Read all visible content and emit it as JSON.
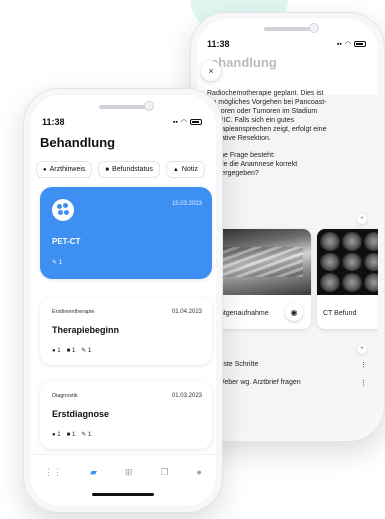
{
  "back": {
    "time": "11:38",
    "title": "ehandlung",
    "close_icon": "×",
    "text_lines": [
      "Radiochemotherapie geplant. Dies ist",
      "ein mögliches Vorgehen bei Pancoast-",
      "Tumoren oder Tumoren im Stadium",
      "IIIA-IIIC. Falls sich ein gutes",
      "Therapieansprechen zeigt, erfolgt eine",
      "operative Resektion."
    ],
    "question_lines": [
      "Offene Frage besteht:",
      "Wurde die Anamnese korrekt",
      "wiedergegeben?"
    ],
    "images": [
      {
        "label": "Röntgenaufnahme",
        "icon": "eye-icon"
      },
      {
        "label": "CT Befund"
      }
    ],
    "next_steps_title": "Nächste Schritte",
    "next_item": "Dr. Weber wg. Arztbrief fragen",
    "more_icon": "⋮"
  },
  "front": {
    "time": "11:38",
    "title": "Behandlung",
    "chips": [
      {
        "label": "Arzthinweis",
        "icon": "person-icon"
      },
      {
        "label": "Befundstatus",
        "icon": "document-icon"
      },
      {
        "label": "Notiz",
        "icon": "note-icon"
      }
    ],
    "cards": [
      {
        "category": "",
        "date": "15.03.2023",
        "title": "PET-CT",
        "meta": {
          "pen": "1"
        }
      },
      {
        "category": "Erstlinientherapie",
        "date": "01.04.2023",
        "title": "Therapiebeginn",
        "meta": {
          "persons": "1",
          "docs": "1",
          "pen": "1"
        }
      },
      {
        "category": "Diagnostik",
        "date": "01.03.2023",
        "title": "Erstdiagnose",
        "meta": {
          "persons": "1",
          "docs": "1",
          "pen": "1"
        }
      }
    ],
    "tabs": [
      "grid-icon",
      "folder-icon",
      "plus-icon",
      "copy-icon",
      "profile-icon"
    ]
  },
  "colors": {
    "accent": "#3d8ff2",
    "blob": "#dff6f1"
  }
}
